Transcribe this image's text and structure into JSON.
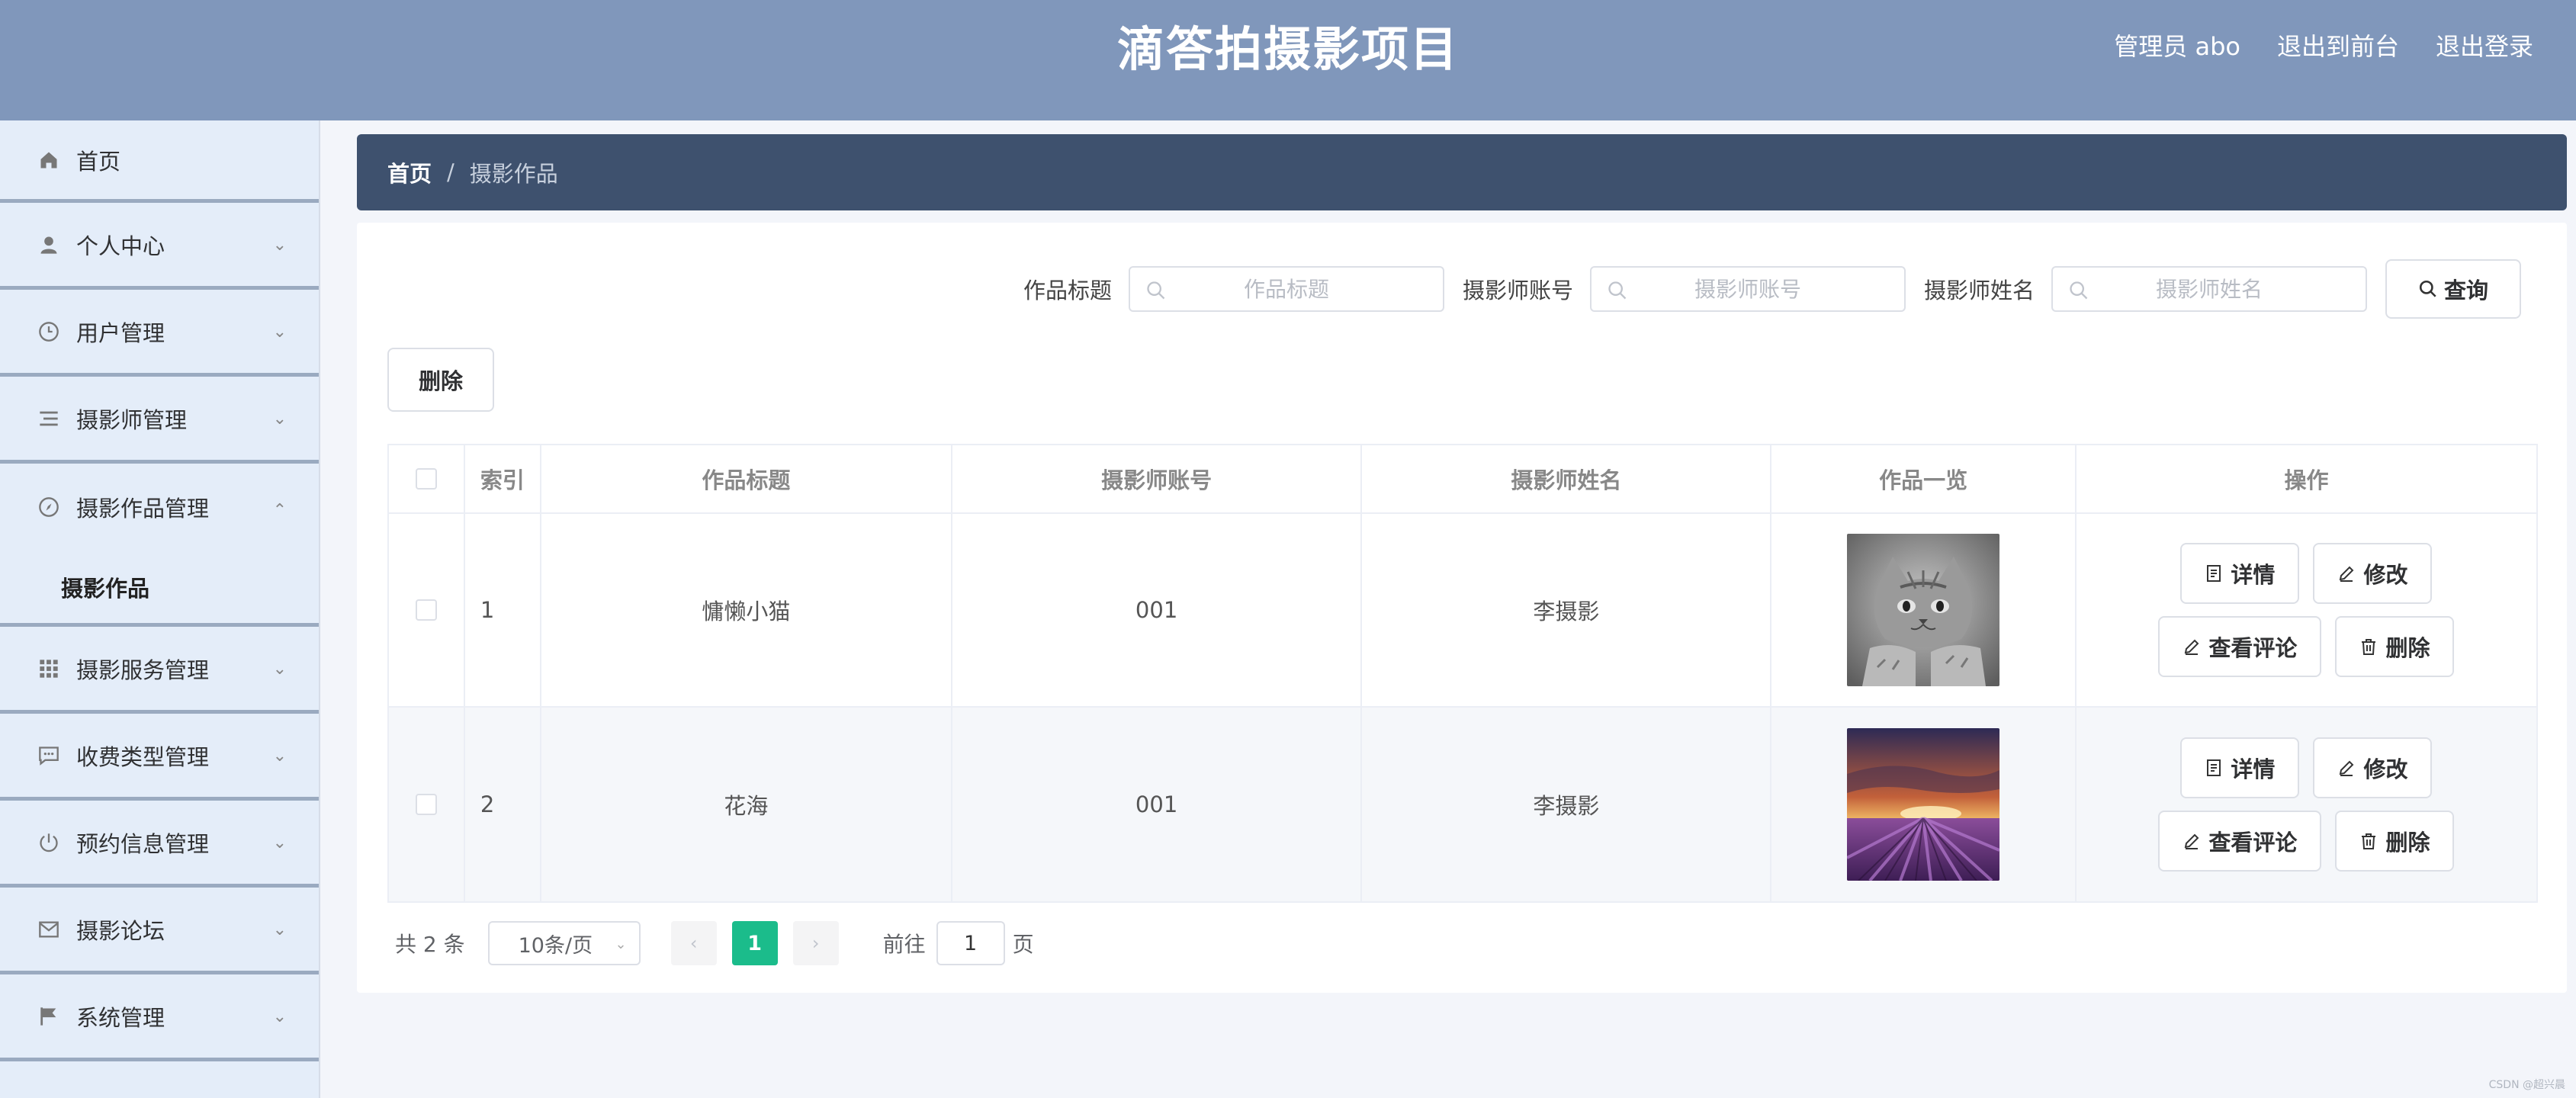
{
  "header": {
    "title": "滴答拍摄影项目",
    "links": [
      "管理员 abo",
      "退出到前台",
      "退出登录"
    ]
  },
  "sidebar": {
    "items": [
      {
        "label": "首页",
        "icon": "home-icon"
      },
      {
        "label": "个人中心",
        "icon": "user-icon"
      },
      {
        "label": "用户管理",
        "icon": "clock-icon"
      },
      {
        "label": "摄影师管理",
        "icon": "list-icon"
      },
      {
        "label": "摄影作品管理",
        "icon": "compass-icon",
        "sub": "摄影作品"
      },
      {
        "label": "摄影服务管理",
        "icon": "grid-icon"
      },
      {
        "label": "收费类型管理",
        "icon": "chat-icon"
      },
      {
        "label": "预约信息管理",
        "icon": "power-icon"
      },
      {
        "label": "摄影论坛",
        "icon": "mail-icon"
      },
      {
        "label": "系统管理",
        "icon": "flag-icon"
      }
    ]
  },
  "breadcrumb": {
    "home": "首页",
    "separator": "/",
    "current": "摄影作品"
  },
  "search": {
    "fields": [
      {
        "label": "作品标题",
        "placeholder": "作品标题"
      },
      {
        "label": "摄影师账号",
        "placeholder": "摄影师账号"
      },
      {
        "label": "摄影师姓名",
        "placeholder": "摄影师姓名"
      }
    ],
    "query_label": "查询"
  },
  "toolbar": {
    "delete_label": "删除"
  },
  "table": {
    "columns": [
      "索引",
      "作品标题",
      "摄影师账号",
      "摄影师姓名",
      "作品一览",
      "操作"
    ],
    "rows": [
      {
        "index": "1",
        "title": "慵懒小猫",
        "account": "001",
        "name": "李摄影"
      },
      {
        "index": "2",
        "title": "花海",
        "account": "001",
        "name": "李摄影"
      }
    ],
    "actions": {
      "detail": "详情",
      "edit": "修改",
      "comments": "查看评论",
      "delete": "删除"
    }
  },
  "pagination": {
    "total": "共 2 条",
    "page_size": "10条/页",
    "current_page": "1",
    "goto_prefix": "前往",
    "goto_value": "1",
    "goto_suffix": "页"
  },
  "watermark": "CSDN @超兴晨",
  "colors": {
    "header": "#8097bb",
    "sidebar": "#e4edf9",
    "breadcrumb": "#3e516e",
    "accent": "#1bbc8b"
  }
}
